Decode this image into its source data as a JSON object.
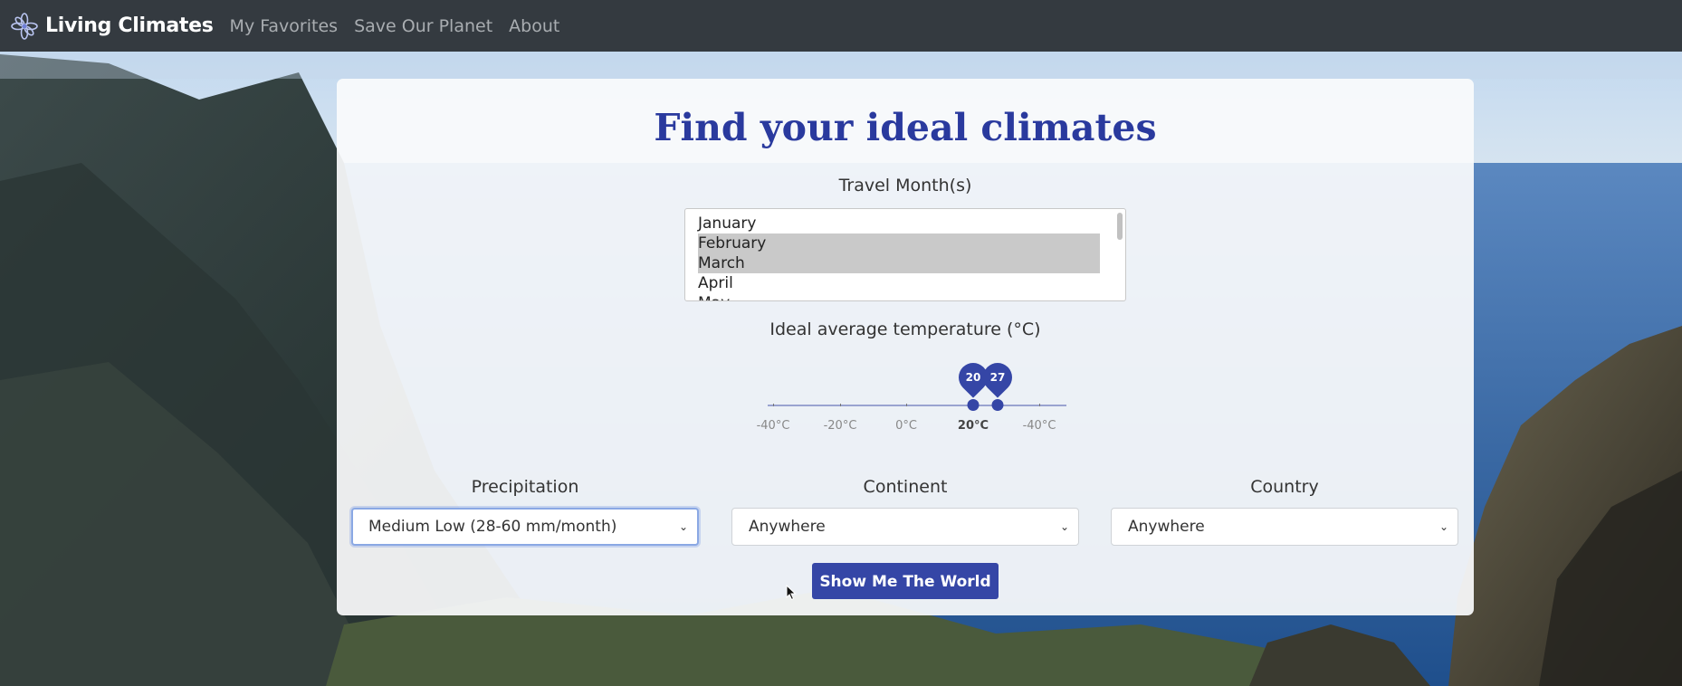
{
  "app": {
    "brand": "Living Climates",
    "nav": [
      "My Favorites",
      "Save Our Planet",
      "About"
    ]
  },
  "form": {
    "title": "Find your ideal climates",
    "months_label": "Travel Month(s)",
    "months": [
      {
        "label": "January",
        "selected": false
      },
      {
        "label": "February",
        "selected": true
      },
      {
        "label": "March",
        "selected": true
      },
      {
        "label": "April",
        "selected": false
      },
      {
        "label": "May",
        "selected": false
      }
    ],
    "temperature": {
      "label": "Ideal average temperature (°C)",
      "min_value": "20",
      "max_value": "27",
      "ticks": [
        "-40°C",
        "-20°C",
        "0°C",
        "20°C",
        "-40°C"
      ]
    },
    "precipitation": {
      "label": "Precipitation",
      "value": "Medium Low (28-60 mm/month)"
    },
    "continent": {
      "label": "Continent",
      "value": "Anywhere"
    },
    "country": {
      "label": "Country",
      "value": "Anywhere"
    },
    "submit_label": "Show Me The World"
  },
  "colors": {
    "navbar": "#343a40",
    "accent": "#3546a6",
    "title": "#2a3a9e"
  },
  "icons": [
    "flower-logo-icon",
    "chevron-down-icon",
    "mouse-cursor-icon"
  ]
}
